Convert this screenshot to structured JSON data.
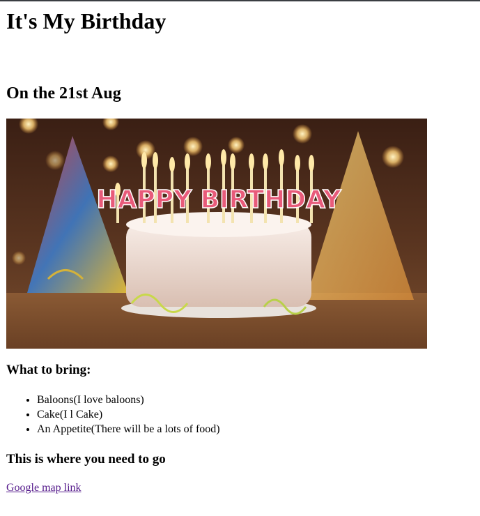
{
  "page": {
    "title": "It's My Birthday",
    "date_heading": "On the 21st Aug",
    "image": {
      "subject": "birthday-cake-photo",
      "banner_text": "HAPPY BIRTHDAY"
    },
    "bring_heading": "What to bring:",
    "bring_items": [
      "Baloons(I love baloons)",
      "Cake(I l Cake)",
      "An Appetite(There will be a lots of food)"
    ],
    "location_heading": "This is where you need to go",
    "map_link_text": "Google map link"
  },
  "colors": {
    "link_visited": "#551a8b",
    "top_border": "#3a3d42"
  }
}
